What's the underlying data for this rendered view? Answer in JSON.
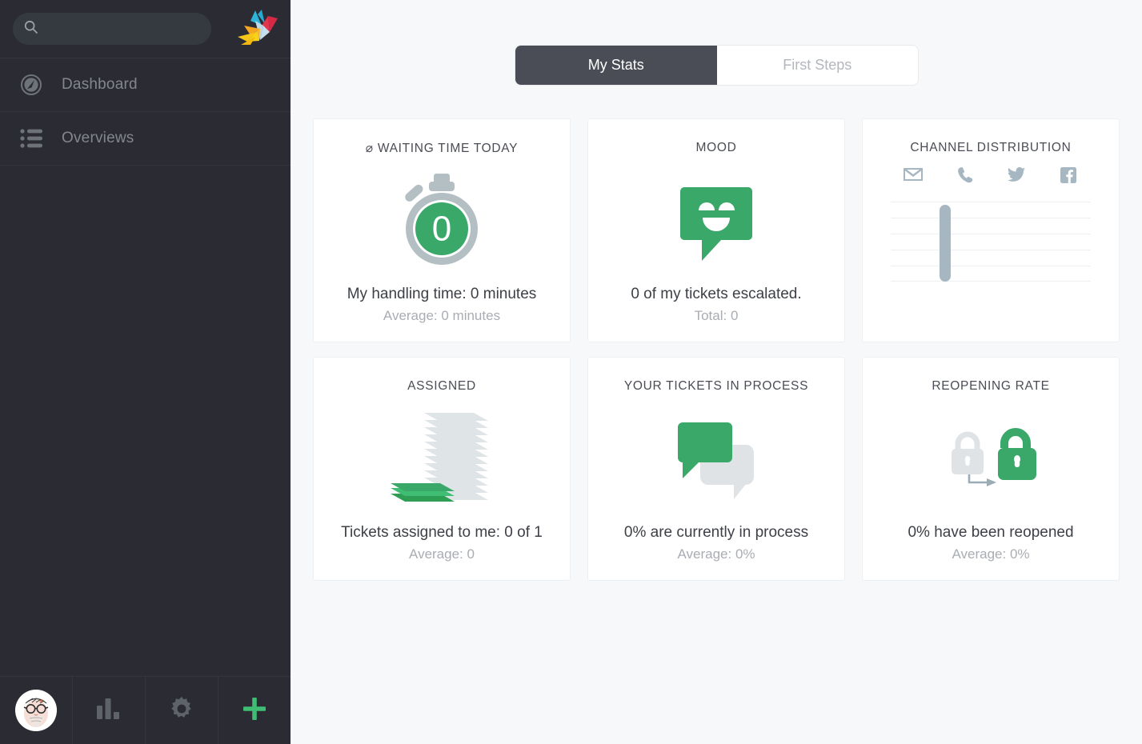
{
  "sidebar": {
    "search": {
      "value": "",
      "placeholder": "",
      "icon": "search-icon"
    },
    "logo": {
      "name": "origami-bird-logo"
    },
    "items": [
      {
        "label": "Dashboard",
        "icon": "speedometer-icon"
      },
      {
        "label": "Overviews",
        "icon": "list-icon"
      }
    ],
    "bottom_bar": [
      {
        "name": "avatar",
        "icon": "user-avatar"
      },
      {
        "name": "reports-button",
        "icon": "bar-chart-icon"
      },
      {
        "name": "settings-button",
        "icon": "gear-icon"
      },
      {
        "name": "add-button",
        "icon": "plus-icon"
      }
    ]
  },
  "main": {
    "tabs": [
      {
        "label": "My Stats",
        "active": true
      },
      {
        "label": "First Steps",
        "active": false
      }
    ],
    "cards": [
      {
        "title": "⌀ WAITING TIME TODAY",
        "icon": "stopwatch-icon",
        "icon_value": "0",
        "primary": "My handling time: 0 minutes",
        "secondary": "Average: 0 minutes"
      },
      {
        "title": "MOOD",
        "icon": "smiley-speech-bubble-icon",
        "primary": "0 of my tickets escalated.",
        "secondary": "Total: 0"
      },
      {
        "title": "CHANNEL DISTRIBUTION",
        "icon": "channel-bar-chart",
        "primary": "",
        "secondary": ""
      },
      {
        "title": "ASSIGNED",
        "icon": "paper-stack-icon",
        "primary": "Tickets assigned to me: 0 of 1",
        "secondary": "Average: 0"
      },
      {
        "title": "YOUR TICKETS IN PROCESS",
        "icon": "double-speech-bubble-icon",
        "primary": "0% are currently in process",
        "secondary": "Average: 0%"
      },
      {
        "title": "REOPENING RATE",
        "icon": "lock-to-unlock-icon",
        "primary": "0% have been reopened",
        "secondary": "Average: 0%"
      }
    ]
  },
  "chart_data": {
    "type": "bar",
    "title": "CHANNEL DISTRIBUTION",
    "categories": [
      "email",
      "phone",
      "twitter",
      "facebook"
    ],
    "category_icons": [
      "email-icon",
      "phone-icon",
      "twitter-icon",
      "facebook-icon"
    ],
    "values": [
      0,
      6,
      0,
      0
    ],
    "ylim": [
      0,
      6
    ],
    "grid": true,
    "gridlines": 6,
    "legend": "none",
    "xlabel": "",
    "ylabel": "",
    "bar_color": "#a6b7c1"
  },
  "colors": {
    "accent_green": "#37a169",
    "sidebar_bg": "#2b2b34",
    "page_bg": "#f7f8fa",
    "tab_active_bg": "#4a4d55",
    "muted_blue_gray": "#a6b7c1"
  }
}
